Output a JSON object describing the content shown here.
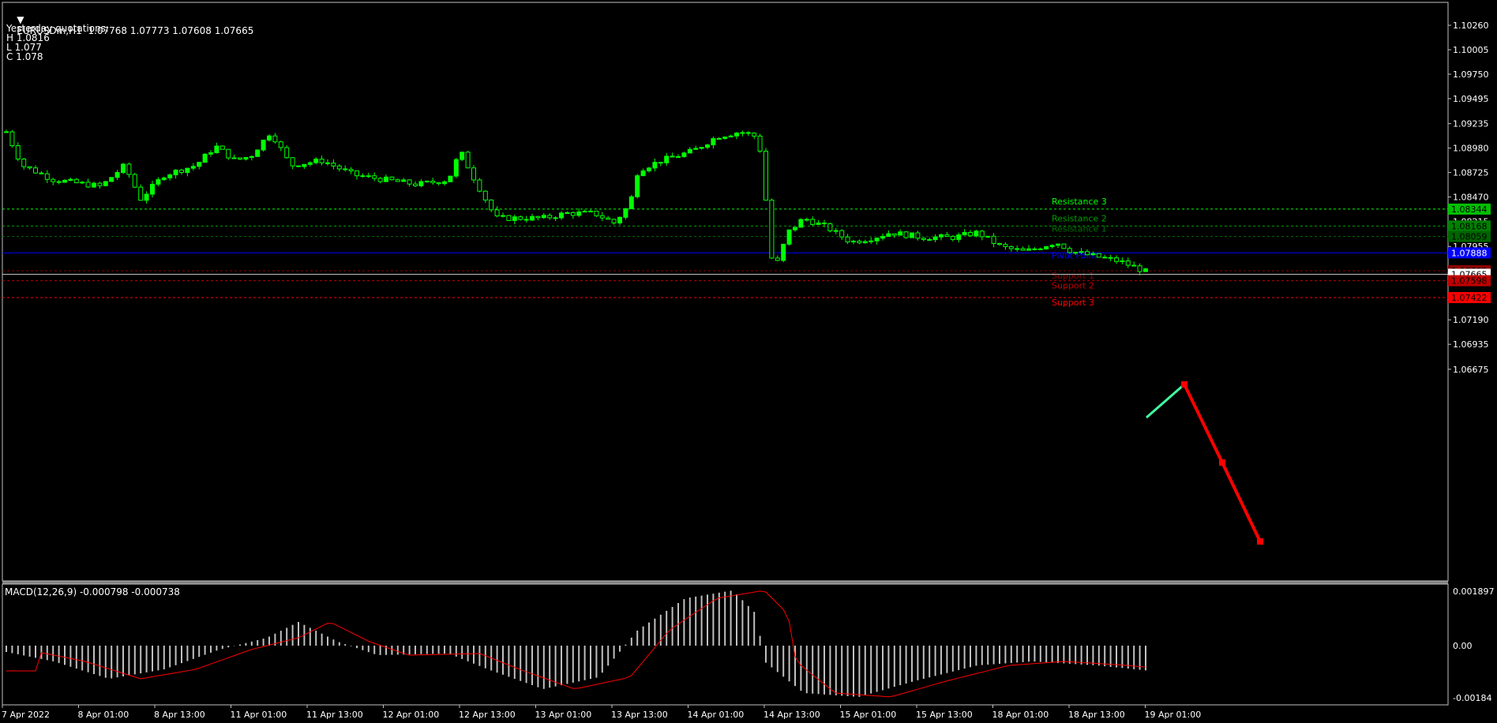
{
  "header": {
    "symbol_line": "EURUSDm,H1  1.07768 1.07773 1.07608 1.07665",
    "dropdown_icon": "triangle-down-icon"
  },
  "quotes": {
    "title": "Yesterday quotations:",
    "high": "H 1.0816",
    "low": "L 1.077",
    "close": "C 1.078"
  },
  "price_axis": {
    "ticks": [
      "1.10260",
      "1.10005",
      "1.09750",
      "1.09495",
      "1.09235",
      "1.08980",
      "1.08725",
      "1.08470",
      "1.08215",
      "1.07955",
      "1.07700",
      "1.07445",
      "1.07190",
      "1.06935",
      "1.06675"
    ],
    "badges": [
      {
        "text": "1.08344",
        "color": "#00c000",
        "fg": "#000"
      },
      {
        "text": "1.08168",
        "color": "#008000",
        "fg": "#000"
      },
      {
        "text": "1.08059",
        "color": "#006400",
        "fg": "#000"
      },
      {
        "text": "1.07888",
        "color": "#0000ff",
        "fg": "#fff"
      },
      {
        "text": "1.07702",
        "color": "#8b0000",
        "fg": "#000"
      },
      {
        "text": "1.07665",
        "color": "#ffffff",
        "fg": "#000"
      },
      {
        "text": "1.07598",
        "color": "#c00000",
        "fg": "#000"
      },
      {
        "text": "1.07422",
        "color": "#ff0000",
        "fg": "#000"
      }
    ]
  },
  "levels": [
    {
      "label": "Resistance 3",
      "color": "#00ff00",
      "price": 1.08344
    },
    {
      "label": "Resistance 2",
      "color": "#00a000",
      "price": 1.08168
    },
    {
      "label": "Resistance 1",
      "color": "#007000",
      "price": 1.08059
    },
    {
      "label": "Pivot Point",
      "color": "#0000ff",
      "price": 1.07888
    },
    {
      "label": "Support 1",
      "color": "#8b0000",
      "price": 1.07702
    },
    {
      "label": "Support 2",
      "color": "#c00000",
      "price": 1.07598
    },
    {
      "label": "Support 3",
      "color": "#ff0000",
      "price": 1.07422
    }
  ],
  "macd": {
    "label": "MACD(12,26,9) -0.000798 -0.000738",
    "ticks": [
      "0.001897",
      "0.00",
      "-0.00184"
    ]
  },
  "time_axis": {
    "ticks": [
      "7 Apr 2022",
      "8 Apr 01:00",
      "8 Apr 13:00",
      "11 Apr 01:00",
      "11 Apr 13:00",
      "12 Apr 01:00",
      "12 Apr 13:00",
      "13 Apr 01:00",
      "13 Apr 13:00",
      "14 Apr 01:00",
      "14 Apr 13:00",
      "15 Apr 01:00",
      "15 Apr 13:00",
      "18 Apr 01:00",
      "18 Apr 13:00",
      "19 Apr 01:00"
    ]
  },
  "colors": {
    "candle": "#00ff00",
    "candle_down_body": "#000000",
    "macd_hist": "#c0c0c0",
    "macd_signal": "#ff0000",
    "forecast_up": "#40ffa0",
    "forecast_down": "#ff0000"
  }
}
